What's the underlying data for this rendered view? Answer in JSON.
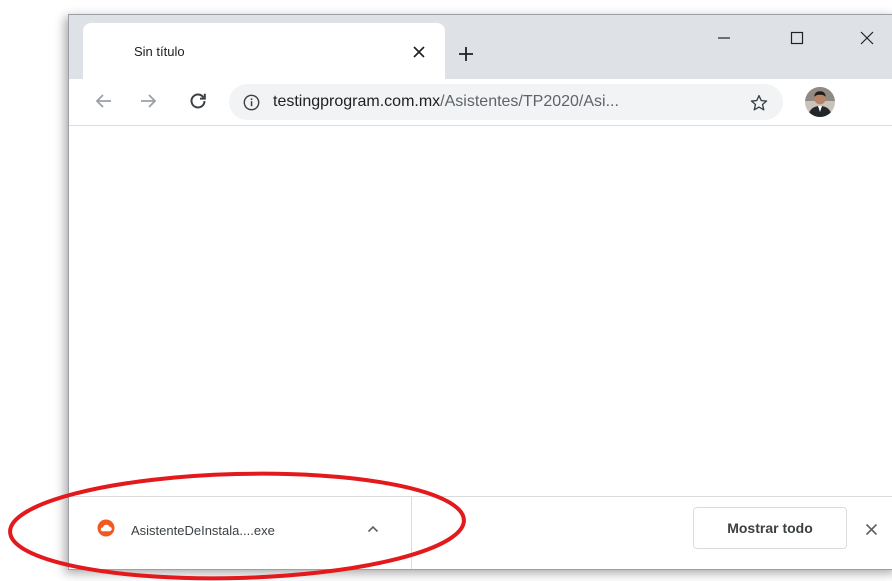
{
  "tab": {
    "title": "Sin título",
    "close_icon": "close-icon"
  },
  "window_controls": {
    "minimize_icon": "minimize-icon",
    "maximize_icon": "maximize-icon",
    "close_icon": "close-icon"
  },
  "toolbar": {
    "back_icon": "arrow-left-icon",
    "forward_icon": "arrow-right-icon",
    "reload_icon": "reload-icon",
    "url_host": "testingprogram.com.mx",
    "url_path": "/Asistentes/TP2020/Asi...",
    "info_icon": "info-icon",
    "bookmark_icon": "star-icon"
  },
  "download_bar": {
    "file_name": "AsistenteDeInstala....exe",
    "file_icon": "cloud-icon",
    "file_icon_color": "#f05a22",
    "show_all_label": "Mostrar todo"
  },
  "annotation": {
    "color": "#e3191b",
    "shape": "ellipse around downloaded file"
  }
}
